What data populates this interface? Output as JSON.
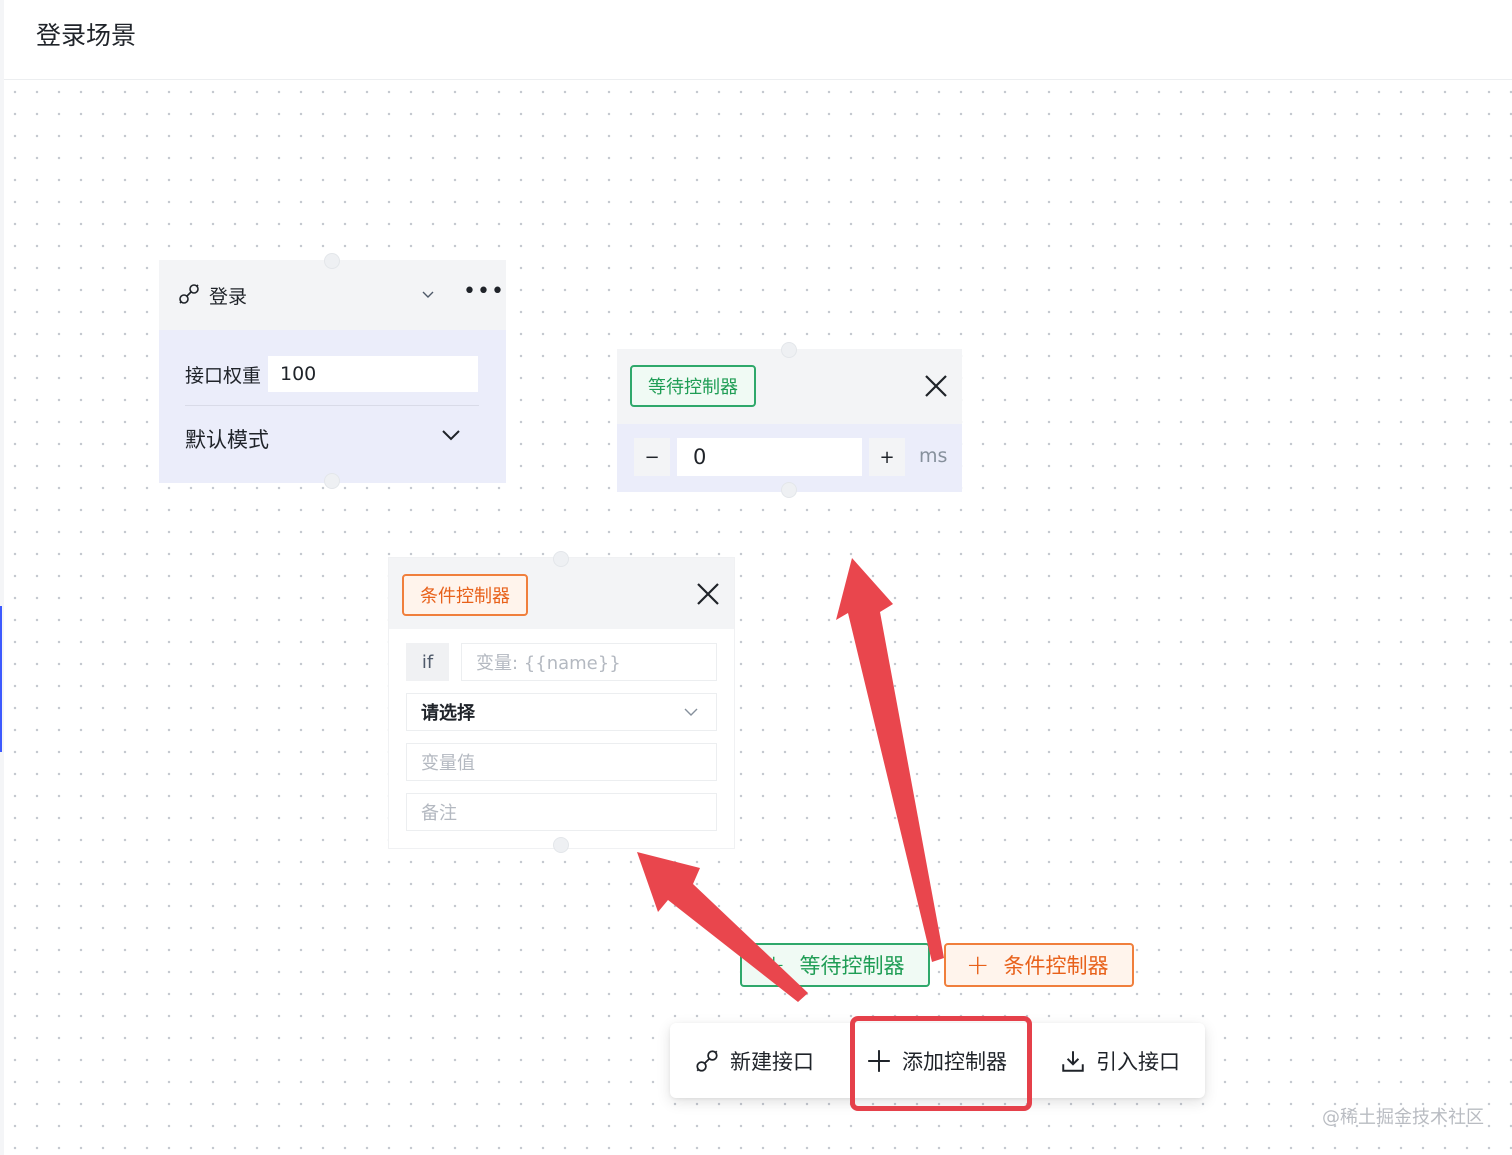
{
  "header": {
    "title": "登录场景"
  },
  "api_node": {
    "name": "登录",
    "weight_label": "接口权重",
    "weight_value": "100",
    "mode": "默认模式",
    "icons": [
      "link-icon",
      "chevron-down-icon",
      "more-icon"
    ]
  },
  "wait_node": {
    "tag": "等待控制器",
    "minus": "−",
    "plus": "+",
    "value": "0",
    "unit": "ms"
  },
  "cond_node": {
    "tag": "条件控制器",
    "if_label": "if",
    "var_placeholder": "变量: {{name}}",
    "select_value": "请选择",
    "value_placeholder": "变量值",
    "note_placeholder": "备注"
  },
  "add_buttons": {
    "wait": "等待控制器",
    "cond": "条件控制器"
  },
  "toolbar": {
    "new_api": "新建接口",
    "add_controller": "添加控制器",
    "import_api": "引入接口"
  },
  "colors": {
    "green": "#1f9d55",
    "orange": "#e8611a",
    "annotation_red": "#e5404a",
    "node_bg": "#ebedfa"
  },
  "watermark": "@稀土掘金技术社区"
}
